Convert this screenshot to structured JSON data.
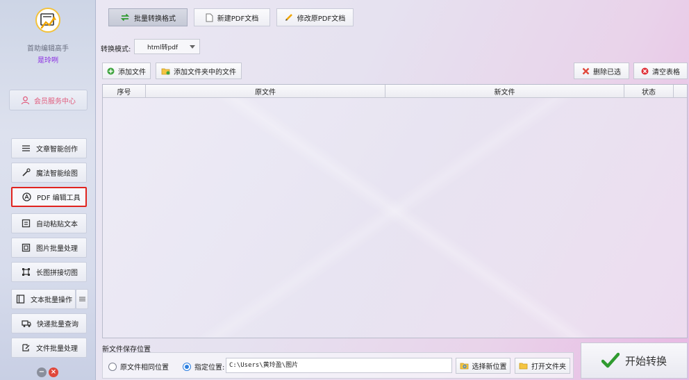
{
  "sidebar": {
    "app_name": "首助编辑高手",
    "user_name": "是玲咧",
    "member_label": "会员服务中心",
    "items": [
      {
        "label": "文章智能创作"
      },
      {
        "label": "魔法智能绘图"
      },
      {
        "label": "PDF 编辑工具"
      },
      {
        "label": "自动粘贴文本"
      },
      {
        "label": "图片批量处理"
      },
      {
        "label": "长图拼接切图"
      },
      {
        "label": "文本批量操作"
      },
      {
        "label": "快递批量查询"
      },
      {
        "label": "文件批量处理"
      }
    ],
    "active_item": "PDF 编辑工具"
  },
  "top_tabs": [
    {
      "label": "批量转换格式"
    },
    {
      "label": "新建PDF文档"
    },
    {
      "label": "修改原PDF文档"
    }
  ],
  "mode": {
    "label": "转换模式:",
    "value": "html转pdf"
  },
  "actions": {
    "add_file": "添加文件",
    "add_folder": "添加文件夹中的文件",
    "delete_selected": "删除已选",
    "clear_table": "清空表格"
  },
  "table": {
    "columns": [
      "序号",
      "原文件",
      "新文件",
      "状态"
    ],
    "rows": []
  },
  "save": {
    "title": "新文件保存位置",
    "option_same": "原文件相同位置",
    "option_custom": "指定位置:",
    "selected": "custom",
    "path": "C:\\Users\\黄玲盈\\图片",
    "choose_btn": "选择新位置",
    "open_btn": "打开文件夹"
  },
  "start_label": "开始转换",
  "colors": {
    "accent_purple": "#8a2be2",
    "active_border": "#e0231e",
    "radio_on": "#2d7fe0",
    "check_green": "#2f9a2f"
  }
}
